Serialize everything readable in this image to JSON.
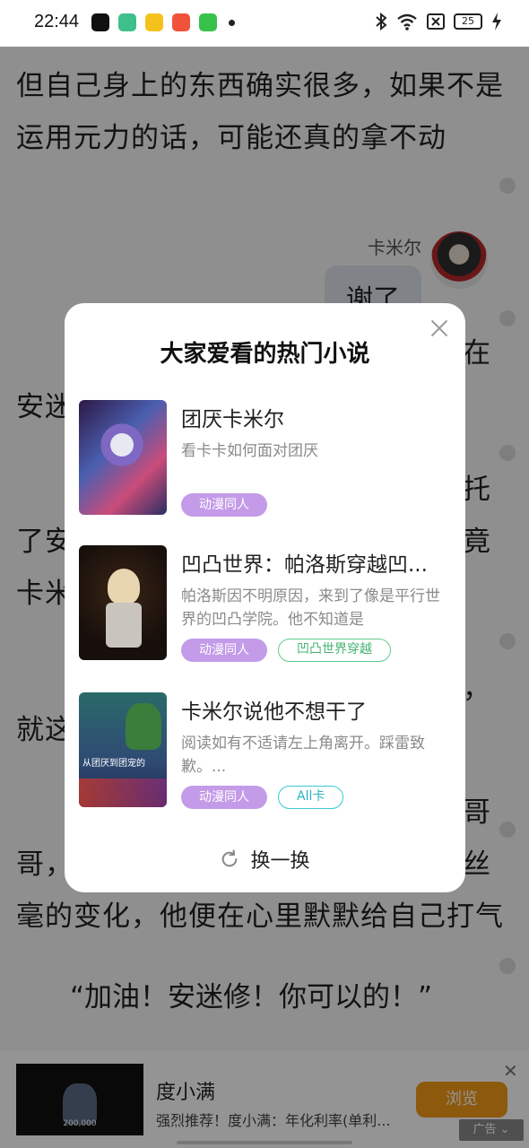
{
  "status_bar": {
    "time": "22:44",
    "battery": "25",
    "app_icons": [
      {
        "name": "tiktok-app-icon",
        "color": "#111111"
      },
      {
        "name": "green-app-icon",
        "color": "#3fbf8a"
      },
      {
        "name": "notes-app-icon",
        "color": "#f4c21b"
      },
      {
        "name": "music-app-icon",
        "color": "#f0533a"
      },
      {
        "name": "store-app-icon",
        "color": "#36c24a"
      }
    ]
  },
  "reader": {
    "line1": "但自己身上的东西确实很多，如果不是",
    "line2": "运用元力的话，可能还真的拿不动",
    "chat_name": "卡米尔",
    "chat_message": "谢了",
    "frag_right1": "在",
    "frag_left1": "安迷",
    "frag_right2": "托",
    "frag_left2": "了安",
    "frag_right3": "竟",
    "frag_left3": "卡米",
    "frag_right4": "，",
    "frag_left4": "就这",
    "frag_right5": "哥",
    "frag_left5": "哥，",
    "frag_right6": "丝",
    "line_bottom": "毫的变化，他便在心里默默给自己打气",
    "quote": "“加油！安迷修！你可以的！”"
  },
  "modal": {
    "title": "大家爱看的热门小说",
    "books": [
      {
        "title": "团厌卡米尔",
        "desc": "看卡卡如何面对团厌",
        "tags": [
          "动漫同人"
        ]
      },
      {
        "title": "凹凸世界：帕洛斯穿越凹...",
        "desc": "帕洛斯因不明原因，来到了像是平行世界的凹凸学院。他不知道是",
        "tags": [
          "动漫同人",
          "凹凸世界穿越"
        ]
      },
      {
        "title": "卡米尔说他不想干了",
        "desc": "阅读如有不适请左上角离开。踩雷致歉。...",
        "tags": [
          "动漫同人",
          "All卡"
        ],
        "cover_caption": "从团厌到团宠的"
      }
    ],
    "refresh_label": "换一换"
  },
  "ad": {
    "title": "度小满",
    "desc": "强烈推荐！度小满：年化利率(单利...",
    "button": "浏览",
    "tag": "广告",
    "thumb_amount": "200,000"
  },
  "colors": {
    "tag_fill": "#c49be8",
    "tag_green": "#63c98c",
    "tag_cyan": "#3cc8d6",
    "ad_button": "#f39a17"
  }
}
